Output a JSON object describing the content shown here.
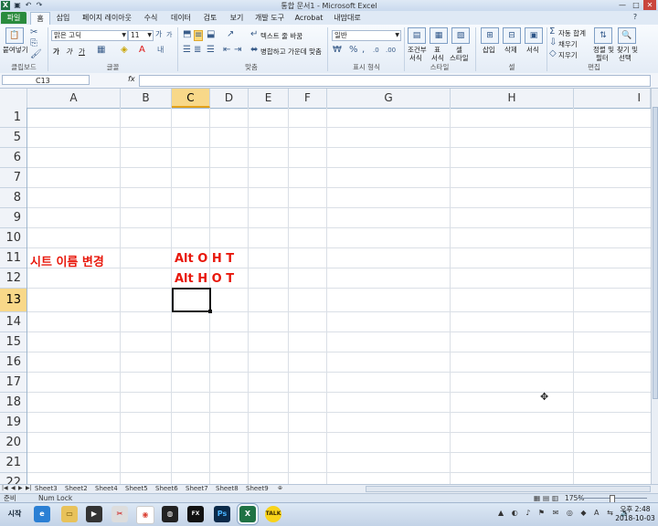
{
  "window": {
    "title": "통합 문서1 - Microsoft Excel",
    "controls": [
      "—",
      "□",
      "✕"
    ]
  },
  "ribbon_tabs": [
    "파일",
    "홈",
    "삽입",
    "페이지 레이아웃",
    "수식",
    "데이터",
    "검토",
    "보기",
    "개발 도구",
    "Acrobat",
    "내맘대로"
  ],
  "ribbon": {
    "clipboard": {
      "paste": "붙여넣기",
      "label": "클립보드"
    },
    "font": {
      "name": "맑은 고딕",
      "size": "11",
      "label": "글꼴",
      "bold": "가",
      "underline": "가"
    },
    "alignment": {
      "wrap": "텍스트 줄 바꿈",
      "merge": "병합하고 가운데 맞춤",
      "label": "맞춤"
    },
    "number": {
      "format": "일반",
      "label": "표시 형식"
    },
    "styles": {
      "cond": [
        "조건부",
        "서식"
      ],
      "table": [
        "표",
        "서식"
      ],
      "cell": [
        "셀",
        "스타일"
      ],
      "label": "스타일"
    },
    "cells": {
      "insert": "삽입",
      "delete": "삭제",
      "format": "서식",
      "label": "셀"
    },
    "editing": {
      "autosum": "자동 합계",
      "fill": "채우기",
      "clear": "지우기",
      "sort": [
        "정렬 및",
        "필터"
      ],
      "find": [
        "찾기 및",
        "선택"
      ],
      "label": "편집"
    }
  },
  "formula_bar": {
    "name_box": "C13",
    "fx": "fx",
    "value": ""
  },
  "columns": [
    "A",
    "B",
    "C",
    "D",
    "E",
    "F",
    "G",
    "H",
    "I"
  ],
  "rows": [
    "1",
    "5",
    "6",
    "7",
    "8",
    "9",
    "10",
    "11",
    "12",
    "13",
    "14",
    "15",
    "16",
    "17",
    "18",
    "19",
    "20",
    "21",
    "22"
  ],
  "cells": {
    "A11": "시트 이름 변경",
    "C11": "Alt O H T",
    "C12": "Alt H O T"
  },
  "selected_cell": "C13",
  "sheet_tabs": [
    "Sheet3",
    "Sheet2",
    "Sheet4",
    "Sheet5",
    "Sheet6",
    "Sheet7",
    "Sheet8",
    "Sheet9"
  ],
  "status": {
    "ready": "준비",
    "numlock": "Num Lock",
    "zoom": "175%"
  },
  "taskbar": {
    "start": "시작",
    "apps": [
      "IE",
      "Folder",
      "Media",
      "Tools",
      "Chrome",
      "App",
      "FX",
      "Ps",
      "Excel",
      "Talk"
    ],
    "tray_icons": [
      "▲",
      "◐",
      "♪",
      "⚑",
      "✉",
      "◎",
      "◆",
      "A",
      "⇆",
      "🔊"
    ],
    "time": "오후 2:48",
    "date": "2018-10-03"
  },
  "colors": {
    "accent_red": "#e8180c",
    "file_tab": "#2a8b3d",
    "selected_header": "#f8d889"
  }
}
